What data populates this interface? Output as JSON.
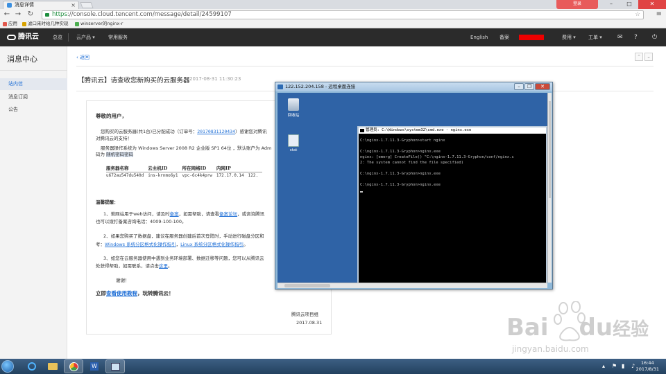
{
  "browser": {
    "tab_title": "消息详情",
    "url_https": "https",
    "url_rest": "://console.cloud.tencent.com/message/detail/24599107",
    "bookmarks": [
      "应用",
      "滤口来时给几种实现",
      "winserver的nginx-r"
    ],
    "account_badge": "登录"
  },
  "header": {
    "logo": "腾讯云",
    "nav": [
      "总览",
      "云产品 ▾",
      "常用服务"
    ],
    "right": [
      "English",
      "备案",
      "费用 ▾",
      "工单 ▾"
    ]
  },
  "sidebar": {
    "title": "消息中心",
    "items": [
      "站内信",
      "消息订阅",
      "公告"
    ]
  },
  "message": {
    "back": "返回",
    "title": "【腾讯云】请查收您新购买的云服务器",
    "time": "2017-08-31 11:30:23",
    "greeting": "尊敬的用户，",
    "p1a": "您购买的云服务器(共1台)已分配成功（订单号：",
    "order_no": "20170831120434",
    "p1b": "）感谢您对腾讯",
    "p1c": "对腾讯云的支持！",
    "p2a": "服务器操作系统为 Windows Server 2008 R2 企业版 SP1 64位 ，默认账户为 Adm",
    "p2b": "码为",
    "p2c": "随机密码密码",
    "table_headers": [
      "服务器名称",
      "云主机ID",
      "所在网络ID",
      "内网IP"
    ],
    "table_row": [
      "u672au547du540d",
      "ins-krnmo6y1",
      "vpc-6c4k4prw",
      "172.17.0.14",
      "122."
    ],
    "tips_title": "温馨提醒：",
    "tip1a": "1、若网站用于web访问，请及时",
    "tip1_link1": "备案",
    "tip1b": "，如需帮助，请查看",
    "tip1_link2": "备案论坛",
    "tip1c": "，或咨询腾讯",
    "tip1d": "也可以拨打备案咨询电话：4009-100-100。",
    "tip2a": "2、如果您购买了数据盘，建议在服务器创建后首次登陆时，手动进行磁盘分区和",
    "tip2b": "考：",
    "tip2_link1": "Windows 系统分区格式化操作指引",
    "tip2_link2": "Linux 系统分区格式化操作指引",
    "tip2c": "。",
    "tip3a": "3、如您在云服务器使用中遇到业务环境部署、数据迁移等问题，您可以从腾讯云",
    "tip3b": "处获得帮助，如需联系，请点击",
    "tip3_link": "这里",
    "tip3c": "。",
    "thanks": "谢谢！",
    "cta_a": "立即",
    "cta_link": "查看使用教程",
    "cta_b": "，玩转腾讯云！",
    "sign": "腾讯云项目组",
    "sign_date": "2017.08.31"
  },
  "rdp": {
    "title": "122.152.204.158 - 远程桌面连接",
    "icons": [
      "回收站",
      "stat"
    ],
    "cmd_title": "管理员: C:\\Windows\\system32\\cmd.exe - nginx.exe",
    "cmd_lines": [
      "C:\\nginx-1.7.11.3-Gryphon>start nginx",
      "",
      "C:\\nginx-1.7.11.3-Gryphon>nginx.exe",
      "nginx: [emerg] CreateFile() \"C:\\nginx-1.7.11.3-Gryphon/conf/nginx.c",
      "2: The system cannot find the file specified)",
      "",
      "C:\\nginx-1.7.11.3-Gryphon>nginx.exe",
      "",
      "C:\\nginx-1.7.11.3-Gryphon>nginx.exe"
    ]
  },
  "watermark": {
    "brand": "Bai",
    "brand2": "du",
    "cn": "经验",
    "url": "jingyan.baidu.com"
  },
  "taskbar": {
    "time": "16:44",
    "date": "2017/8/31"
  }
}
